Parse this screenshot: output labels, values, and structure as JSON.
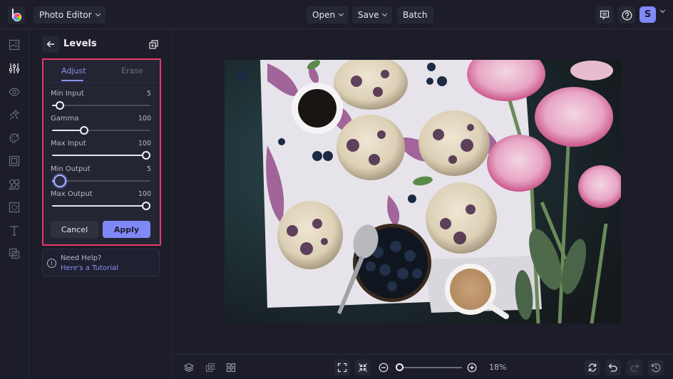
{
  "app": {
    "mode_selector": "Photo Editor",
    "menu": [
      {
        "label": "Open",
        "has_dropdown": true
      },
      {
        "label": "Save",
        "has_dropdown": true
      },
      {
        "label": "Batch",
        "has_dropdown": false
      }
    ],
    "user_initial": "S",
    "accent_color": "#8088f8",
    "highlight_color": "#e8386d"
  },
  "left_rail": {
    "items": [
      {
        "icon": "image-icon",
        "label": "Image",
        "active": false
      },
      {
        "icon": "sliders-icon",
        "label": "Edit",
        "active": true
      },
      {
        "icon": "eye-icon",
        "label": "Touch Up",
        "active": false
      },
      {
        "icon": "sparkle-icon",
        "label": "Effects",
        "active": false
      },
      {
        "icon": "palette-icon",
        "label": "Artsy",
        "active": false
      },
      {
        "icon": "frame-icon",
        "label": "Frames",
        "active": false
      },
      {
        "icon": "shapes-icon",
        "label": "Graphics",
        "active": false
      },
      {
        "icon": "texture-icon",
        "label": "Textures",
        "active": false
      },
      {
        "icon": "text-icon",
        "label": "Text",
        "active": false
      },
      {
        "icon": "overlay-icon",
        "label": "Overlays",
        "active": false
      }
    ]
  },
  "panel": {
    "title": "Levels",
    "tabs": [
      {
        "label": "Adjust",
        "active": true
      },
      {
        "label": "Erase",
        "active": false
      }
    ],
    "sliders": [
      {
        "label": "Min Input",
        "value": "5",
        "fraction": 0.08
      },
      {
        "label": "Gamma",
        "value": "100",
        "fraction": 0.34
      },
      {
        "label": "Max Input",
        "value": "100",
        "fraction": 1.0
      },
      {
        "label": "Min Output",
        "value": "5",
        "fraction": 0.08,
        "active": true
      },
      {
        "label": "Max Output",
        "value": "100",
        "fraction": 1.0
      }
    ],
    "cancel_label": "Cancel",
    "apply_label": "Apply",
    "help": {
      "title": "Need Help?",
      "link": "Here's a Tutorial"
    }
  },
  "canvas": {
    "image_description": "Blueberry scones on parchment with coffee cups, bowl of blueberries, spoon and pink peonies on dark surface"
  },
  "bottom_bar": {
    "zoom_percent": "18%",
    "zoom_fraction": 0.0
  }
}
